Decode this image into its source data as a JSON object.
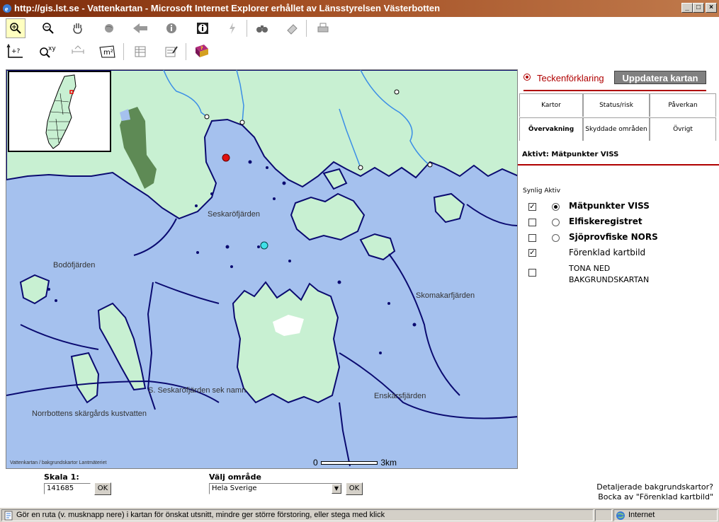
{
  "window": {
    "title": "http://gis.lst.se - Vattenkartan - Microsoft Internet Explorer erhållet av Länsstyrelsen Västerbotten"
  },
  "toolbar": {
    "row1": [
      "zoom-in-icon",
      "zoom-out-icon",
      "pan-hand-icon",
      "globe-icon",
      "back-arrow-icon",
      "info-icon",
      "info-dark-icon",
      "lightning-icon",
      "binoculars-icon",
      "eraser-icon",
      "print-icon"
    ],
    "row2": [
      "measure-coordinate-icon",
      "zoom-xy-icon",
      "measure-distance-icon",
      "area-m2-icon",
      "table-icon",
      "edit-form-icon",
      "help-book-icon"
    ]
  },
  "map": {
    "labels": {
      "seskarofjarden": "Seskaröfjärden",
      "bodofjarden": "Bodöfjärden",
      "skomakarfjarden": "Skomakarfjärden",
      "s_seskaro": "S. Seskaröfjärden sek namn",
      "norrbotten": "Norrbottens skärgårds kustvatten",
      "enskarsfjarden": "Enskärsfjärden"
    },
    "copyright": "Vattenkartan / bakgrundskartor Lantmäteriet",
    "scale_start": "0",
    "scale_end": "3km",
    "colors": {
      "water": "#a5c1ee",
      "land": "#c8f0d2",
      "forest": "#5e8a55",
      "shore": "#0a0a70",
      "river": "#3b8ee6"
    }
  },
  "panel": {
    "legend_link": "Teckenförklaring",
    "update_button": "Uppdatera kartan",
    "tabs": [
      "Kartor",
      "Status/risk",
      "Påverkan",
      "Övervakning",
      "Skyddade områden",
      "Övrigt"
    ],
    "active_label": "Aktivt: Mätpunkter VISS",
    "col_headers": "Synlig Aktiv",
    "layers": [
      {
        "name": "Mätpunkter VISS",
        "visible": true,
        "active": true,
        "bold": true
      },
      {
        "name": "Elfiskeregistret",
        "visible": false,
        "active": false,
        "bold": true
      },
      {
        "name": "Sjöprovfiske NORS",
        "visible": false,
        "active": false,
        "bold": true
      },
      {
        "name": "Förenklad kartbild",
        "visible": true,
        "active": null,
        "bold": false
      },
      {
        "name": "TONA NED BAKGRUNDSKARTAN",
        "visible": false,
        "active": null,
        "bold": false
      }
    ],
    "detail_text_1": "Detaljerade bakgrundskartor?",
    "detail_text_2": "Bocka av \"Förenklad kartbild\""
  },
  "bottom": {
    "scale_label": "Skala 1:",
    "scale_value": "141685",
    "ok1": "OK",
    "area_label": "Välj område",
    "area_value": "Hela Sverige",
    "ok2": "OK"
  },
  "status": {
    "message": "Gör en ruta (v. musknapp nere) i kartan för önskat utsnitt, mindre ger större förstoring, eller stega med klick",
    "zone": "Internet"
  }
}
